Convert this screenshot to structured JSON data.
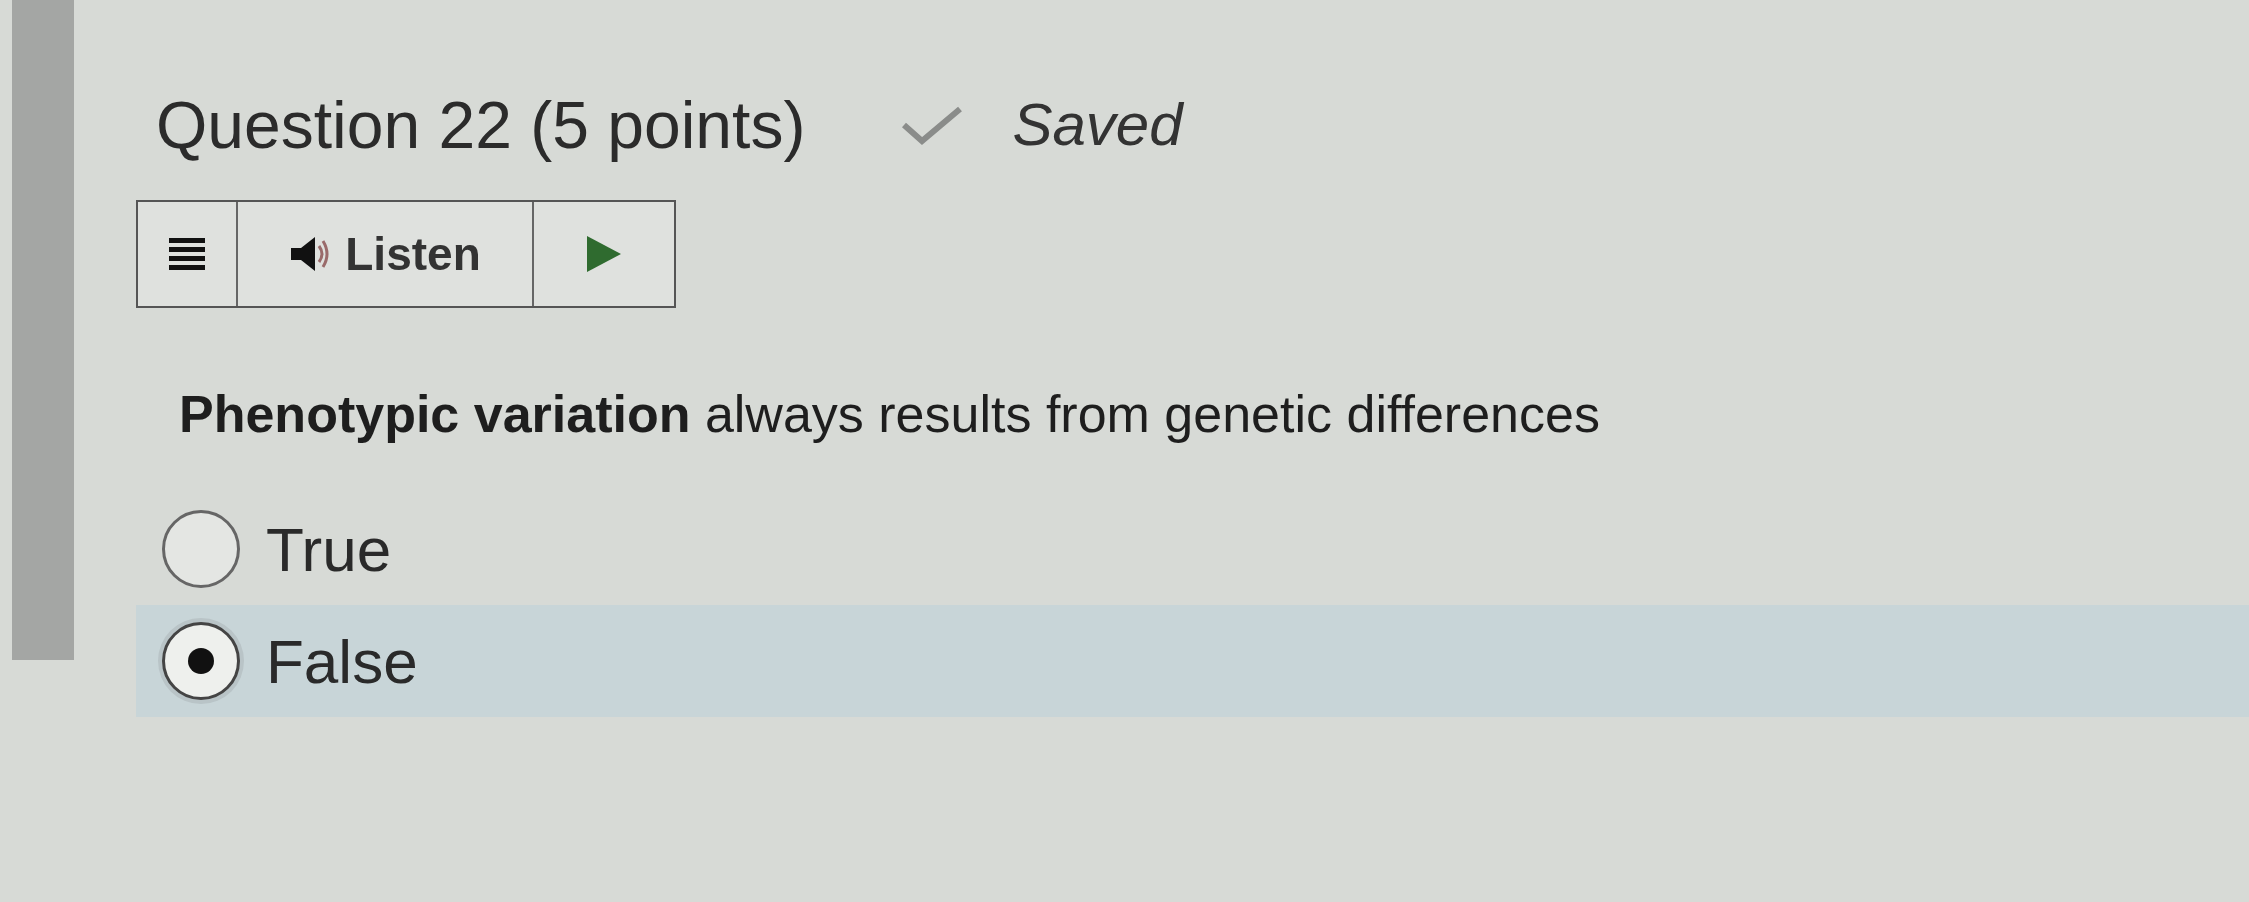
{
  "question": {
    "title": "Question 22 (5 points)",
    "status": "Saved"
  },
  "listen_toolbar": {
    "label": "Listen"
  },
  "prompt": "**Phenotypic variation** always results from genetic differences",
  "options": [
    {
      "label": "True",
      "selected": false
    },
    {
      "label": "False",
      "selected": true
    }
  ]
}
